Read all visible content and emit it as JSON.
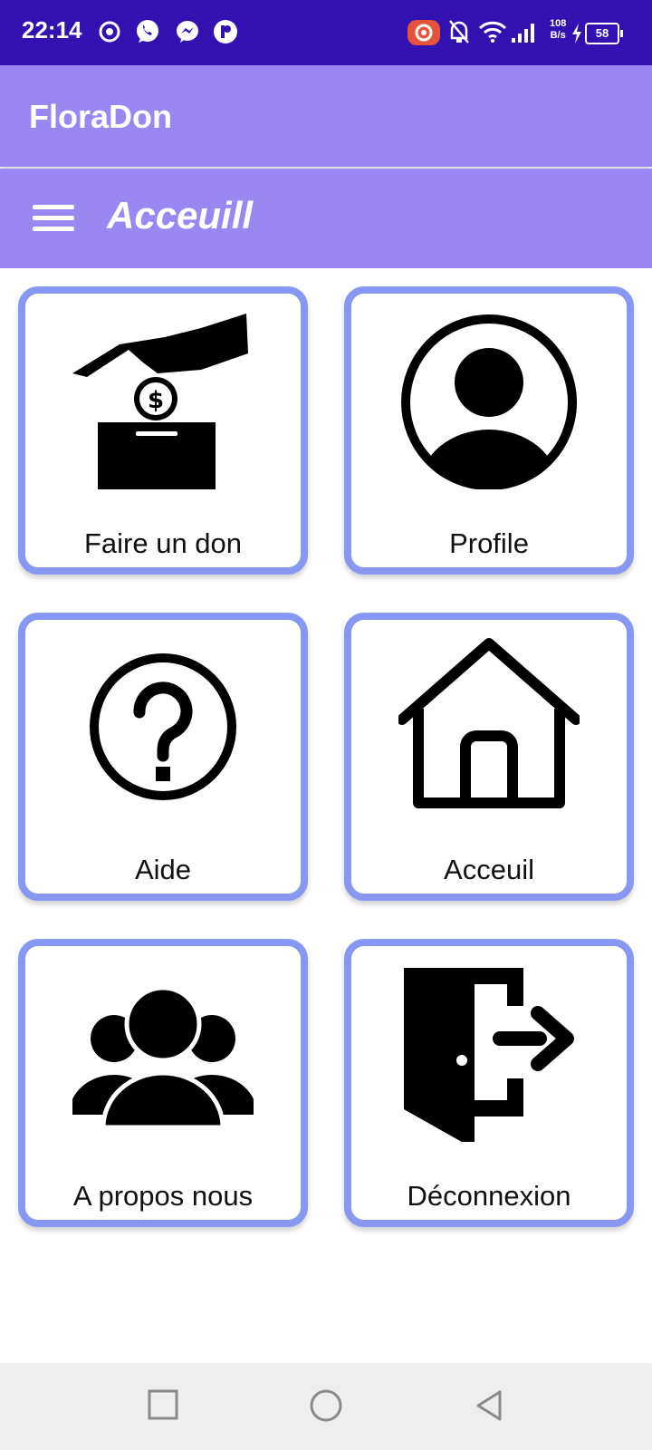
{
  "status_bar": {
    "time": "22:14",
    "network_speed_value": "108",
    "network_speed_unit": "B/s",
    "battery_level": "58",
    "bg_color": "#3311b0"
  },
  "app_bar": {
    "title": "FloraDon",
    "bg_color": "#9b87f2"
  },
  "toolbar": {
    "title": "Acceuill",
    "menu_icon": "hamburger-menu-icon"
  },
  "tiles": [
    {
      "label": "Faire un don",
      "icon": "donation-icon"
    },
    {
      "label": "Profile",
      "icon": "profile-icon"
    },
    {
      "label": "Aide",
      "icon": "help-icon"
    },
    {
      "label": "Acceuil",
      "icon": "home-icon"
    },
    {
      "label": "A propos nous",
      "icon": "group-icon"
    },
    {
      "label": "Déconnexion",
      "icon": "logout-icon"
    }
  ],
  "tile_border_color": "#8897f2",
  "nav_bar": {
    "buttons": [
      "recent-apps-icon",
      "home-circle-icon",
      "back-icon"
    ]
  }
}
